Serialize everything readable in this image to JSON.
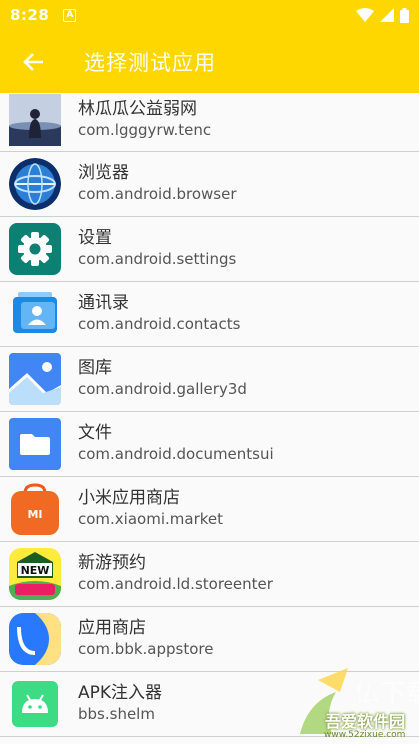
{
  "status_bar": {
    "time": "8:28",
    "notification_letter": "A"
  },
  "toolbar": {
    "title": "选择测试应用"
  },
  "colors": {
    "appbar": "#ffd700",
    "divider": "#cfcfcf"
  },
  "apps": [
    {
      "name": "林瓜瓜公益弱网",
      "package": "com.lgggyrw.tenc",
      "icon": "photo-avatar-icon"
    },
    {
      "name": "浏览器",
      "package": "com.android.browser",
      "icon": "browser-globe-icon"
    },
    {
      "name": "设置",
      "package": "com.android.settings",
      "icon": "settings-gear-icon"
    },
    {
      "name": "通讯录",
      "package": "com.android.contacts",
      "icon": "contacts-icon"
    },
    {
      "name": "图库",
      "package": "com.android.gallery3d",
      "icon": "gallery-icon"
    },
    {
      "name": "文件",
      "package": "com.android.documentsui",
      "icon": "folder-icon"
    },
    {
      "name": "小米应用商店",
      "package": "com.xiaomi.market",
      "icon": "shopping-bag-icon"
    },
    {
      "name": "新游预约",
      "package": "com.android.ld.storeenter",
      "icon": "new-games-icon"
    },
    {
      "name": "应用商店",
      "package": "com.bbk.appstore",
      "icon": "app-store-icon"
    },
    {
      "name": "APK注入器",
      "package": "bbs.shelm",
      "icon": "android-robot-icon"
    }
  ],
  "watermark": {
    "text": "吾爱软件园",
    "url": "www.52zixue.com"
  }
}
